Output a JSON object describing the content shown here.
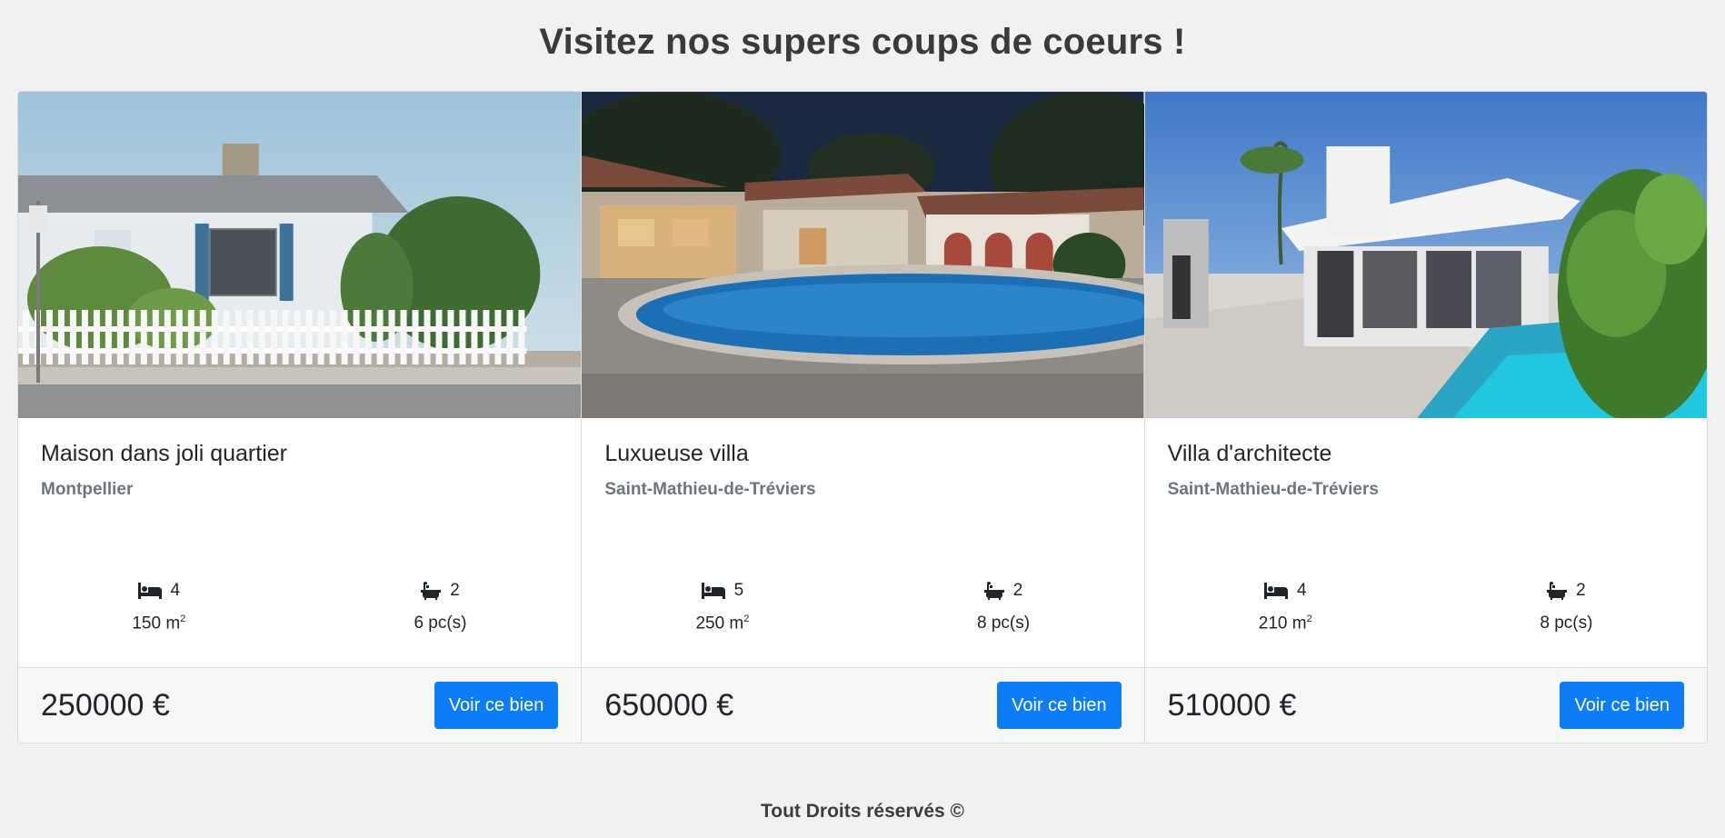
{
  "page": {
    "title": "Visitez nos supers coups de coeurs !",
    "footer": "Tout Droits réservés ©"
  },
  "colors": {
    "background": "#f1f1f1",
    "button": "#0d7cf7",
    "subtitle": "#6c757d"
  },
  "listings": [
    {
      "image": "white house with picket fence",
      "title": "Maison dans joli quartier",
      "city": "Montpellier",
      "bedrooms": "4",
      "bathrooms": "2",
      "area": "150 m",
      "area_unit_sup": "2",
      "rooms": "6 pc(s)",
      "price": "250000 €",
      "button": "Voir ce bien"
    },
    {
      "image": "villa with pool at night",
      "title": "Luxueuse villa",
      "city": "Saint-Mathieu-de-Tréviers",
      "bedrooms": "5",
      "bathrooms": "2",
      "area": "250 m",
      "area_unit_sup": "2",
      "rooms": "8 pc(s)",
      "price": "650000 €",
      "button": "Voir ce bien"
    },
    {
      "image": "modern white architect villa",
      "title": "Villa d'architecte",
      "city": "Saint-Mathieu-de-Tréviers",
      "bedrooms": "4",
      "bathrooms": "2",
      "area": "210 m",
      "area_unit_sup": "2",
      "rooms": "8 pc(s)",
      "price": "510000 €",
      "button": "Voir ce bien"
    }
  ],
  "icons": {
    "bedroom": "bed-icon",
    "bathroom": "bath-icon"
  }
}
